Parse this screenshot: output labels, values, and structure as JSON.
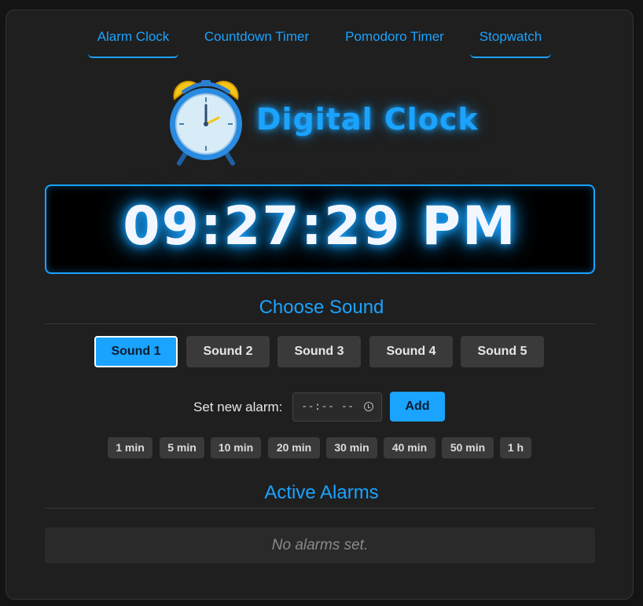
{
  "nav": {
    "tabs": [
      {
        "label": "Alarm Clock",
        "active": true
      },
      {
        "label": "Countdown Timer",
        "active": false
      },
      {
        "label": "Pomodoro Timer",
        "active": false
      },
      {
        "label": "Stopwatch",
        "active": true
      }
    ]
  },
  "header": {
    "icon": "alarm-clock-icon",
    "title": "Digital Clock"
  },
  "clock": {
    "time": "09:27:29 PM"
  },
  "sound": {
    "section_title": "Choose Sound",
    "options": [
      "Sound 1",
      "Sound 2",
      "Sound 3",
      "Sound 4",
      "Sound 5"
    ],
    "selected": "Sound 1"
  },
  "alarm_form": {
    "label": "Set new alarm:",
    "time_value": "--:-- --",
    "add_label": "Add",
    "quick_presets": [
      "1 min",
      "5 min",
      "10 min",
      "20 min",
      "30 min",
      "40 min",
      "50 min",
      "1 h"
    ]
  },
  "active_alarms": {
    "section_title": "Active Alarms",
    "empty_message": "No alarms set."
  },
  "colors": {
    "accent": "#1aa3ff",
    "background": "#1f1f1f",
    "button": "#3a3a3a"
  }
}
